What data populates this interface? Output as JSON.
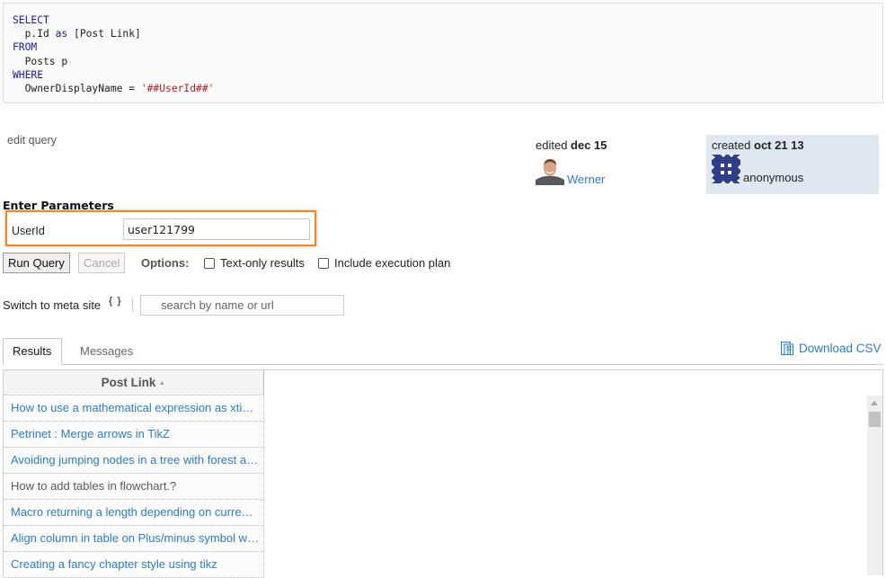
{
  "query": {
    "lines": [
      {
        "kind": "kw",
        "text": "SELECT"
      },
      {
        "kind": "mixed",
        "parts": [
          {
            "kind": "plain",
            "text": "  p.Id "
          },
          {
            "kind": "kw",
            "text": "as"
          },
          {
            "kind": "plain",
            "text": " [Post Link]"
          }
        ]
      },
      {
        "kind": "kw",
        "text": "FROM"
      },
      {
        "kind": "plain",
        "text": "  Posts p"
      },
      {
        "kind": "kw",
        "text": "WHERE"
      },
      {
        "kind": "mixed",
        "parts": [
          {
            "kind": "plain",
            "text": "  OwnerDisplayName = "
          },
          {
            "kind": "str",
            "text": "'##UserId##'"
          }
        ]
      }
    ],
    "colors": {
      "keyword": "#1a1aa6",
      "string": "#b22222"
    }
  },
  "edit_query_label": "edit query",
  "edited": {
    "prefix": "edited",
    "date": "dec 15",
    "user": "Werner"
  },
  "created": {
    "prefix": "created",
    "date": "oct 21 13",
    "user": "anonymous"
  },
  "parameters": {
    "title": "Enter Parameters",
    "fields": [
      {
        "label": "UserId",
        "value": "user121799"
      }
    ],
    "highlight_color": "#f08c1f"
  },
  "actions": {
    "run_label": "Run Query",
    "cancel_label": "Cancel",
    "options_label": "Options:",
    "text_only_label": "Text-only results",
    "text_only_checked": false,
    "exec_plan_label": "Include execution plan",
    "exec_plan_checked": false
  },
  "meta": {
    "switch_label": "Switch to meta site",
    "braces_icon": "{ }",
    "search_placeholder": "search by name or url"
  },
  "tabs": [
    {
      "label": "Results",
      "active": true
    },
    {
      "label": "Messages",
      "active": false
    }
  ],
  "download_csv_label": "Download CSV",
  "link_color": "#2a7ccd",
  "results": {
    "column": "Post Link",
    "sort_icon": "▲",
    "rows": [
      {
        "text": "How to use a mathematical expression as xti…",
        "visited": false
      },
      {
        "text": "Petrinet : Merge arrows in TikZ",
        "visited": false
      },
      {
        "text": "Avoiding jumping nodes in a tree with forest a…",
        "visited": false
      },
      {
        "text": "How to add tables in flowchart.?",
        "visited": true
      },
      {
        "text": "Macro returning a length depending on curre…",
        "visited": false
      },
      {
        "text": "Align column in table on Plus/minus symbol w…",
        "visited": false
      },
      {
        "text": "Creating a fancy chapter style using tikz",
        "visited": false
      }
    ]
  }
}
